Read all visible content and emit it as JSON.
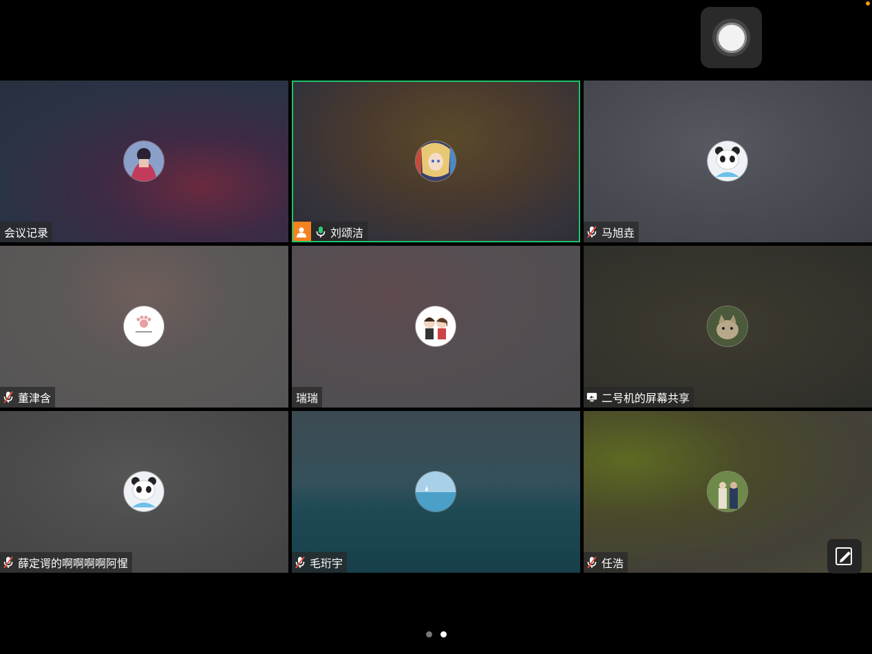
{
  "colors": {
    "accent_active": "#1fc46b",
    "host_badge": "#f58220",
    "mic_on": "#2ecc71",
    "mic_muted": "#e74c3c"
  },
  "toolbar": {
    "assistive_icon": "assistive-touch-icon",
    "draw_icon": "edit-draw-icon"
  },
  "participants": [
    {
      "name": "会议记录",
      "mic": "none",
      "avatar": "girl-photo-avatar"
    },
    {
      "name": "刘颂洁",
      "mic": "on",
      "host": true,
      "active": true,
      "avatar": "anime-avatar"
    },
    {
      "name": "马旭垚",
      "mic": "muted",
      "avatar": "panda-avatar"
    },
    {
      "name": "董津含",
      "mic": "muted",
      "avatar": "paw-logo-avatar"
    },
    {
      "name": "瑞瑞",
      "mic": "none",
      "avatar": "cartoon-couple-avatar"
    },
    {
      "name": "二号机的屏幕共享",
      "mic": "screen-share",
      "avatar": "cat-photo-avatar"
    },
    {
      "name": "薛定谔的啊啊啊啊阿惺",
      "mic": "muted",
      "avatar": "panda-avatar"
    },
    {
      "name": "毛珩宇",
      "mic": "muted",
      "avatar": "sea-photo-avatar"
    },
    {
      "name": "任浩",
      "mic": "muted",
      "avatar": "couple-photo-avatar"
    }
  ],
  "pager": {
    "pages": 2,
    "current": 2
  }
}
